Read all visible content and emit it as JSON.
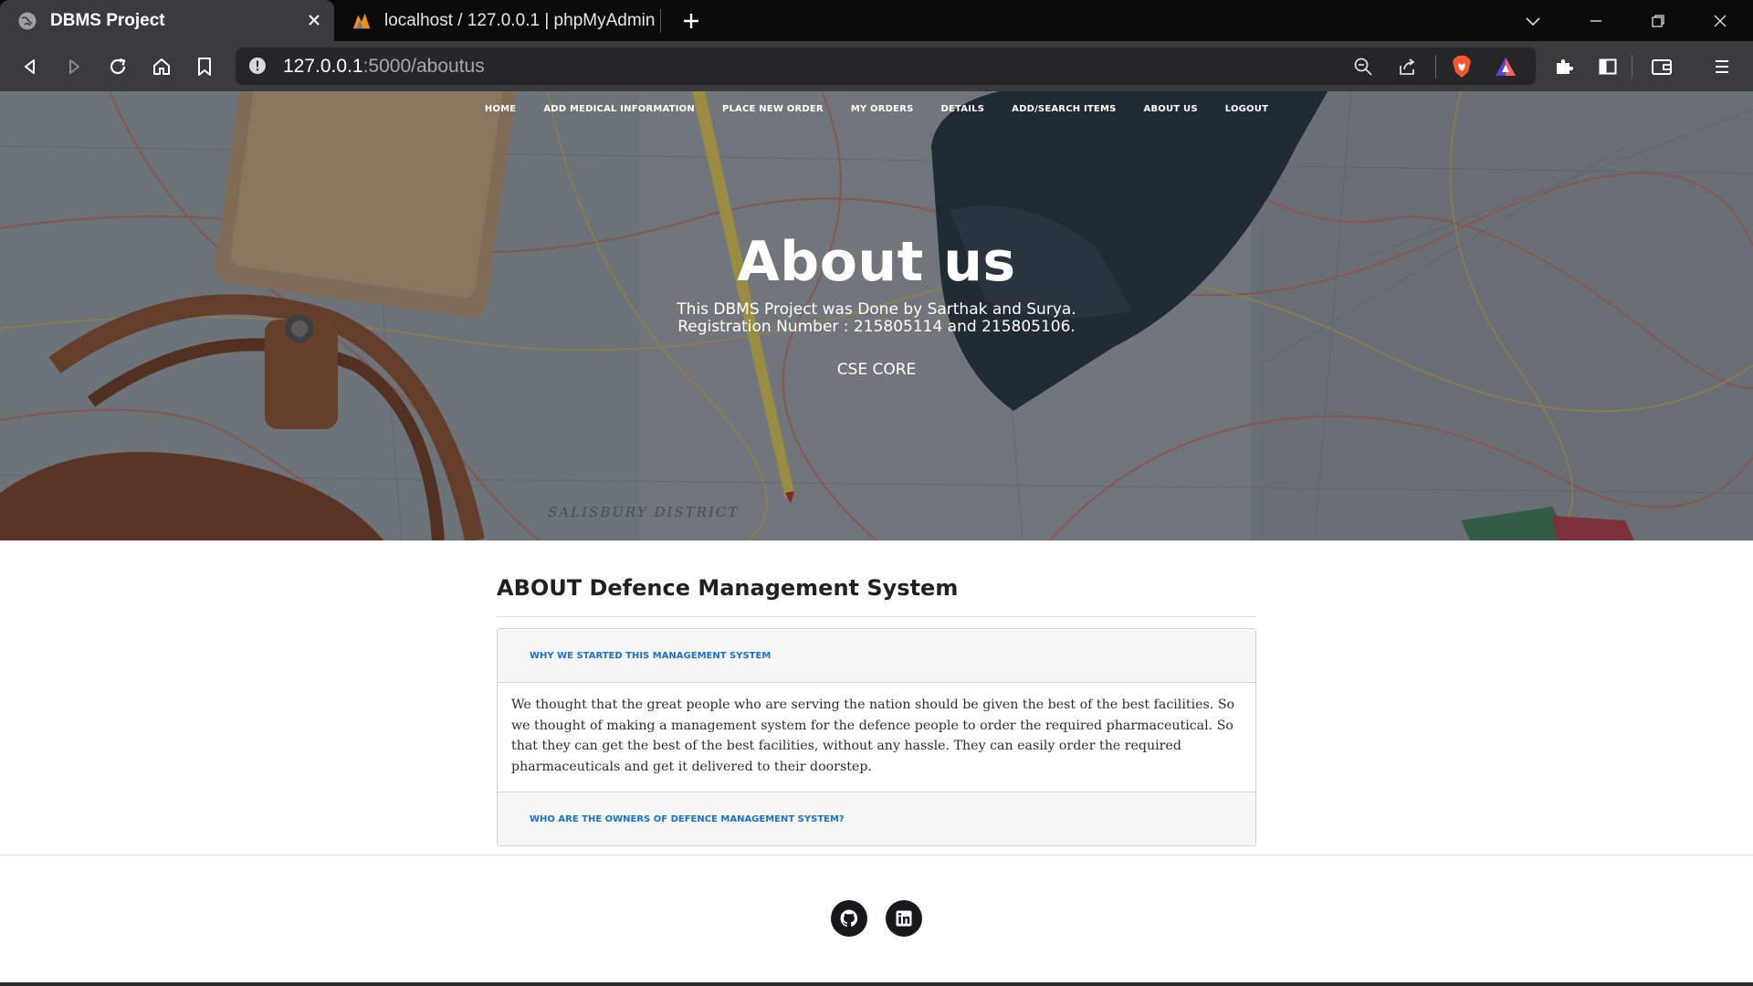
{
  "browser": {
    "tabs": [
      {
        "title": "DBMS Project",
        "active": true
      },
      {
        "title": "localhost / 127.0.0.1 | phpMyAdmin 5.",
        "active": false
      }
    ],
    "url_host": "127.0.0.1",
    "url_path": ":5000/aboutus"
  },
  "nav": {
    "items": [
      "HOME",
      "ADD MEDICAL INFORMATION",
      "PLACE NEW ORDER",
      "MY ORDERS",
      "DETAILS",
      "ADD/SEARCH ITEMS",
      "ABOUT US",
      "LOGOUT"
    ]
  },
  "hero": {
    "title": "About us",
    "line1": "This DBMS Project was Done by Sarthak and Surya.",
    "line2": "Registration Number : 215805114 and 215805106.",
    "line3": "CSE CORE",
    "map_label": "SALISBURY DISTRICT"
  },
  "about": {
    "heading": "ABOUT Defence Management System",
    "q1": "WHY WE STARTED THIS MANAGEMENT SYSTEM",
    "a1": "We thought that the great people who are serving the nation should be given the best of the best facilities. So we thought of making a management system for the defence people to order the required pharmaceutical. So that they can get the best of the best facilities, without any hassle. They can easily order the required pharmaceuticals and get it delivered to their doorstep.",
    "q2": "WHO ARE THE OWNERS OF DEFENCE MANAGEMENT SYSTEM?"
  },
  "footer": {
    "icons": [
      "github-icon",
      "linkedin-icon"
    ]
  }
}
